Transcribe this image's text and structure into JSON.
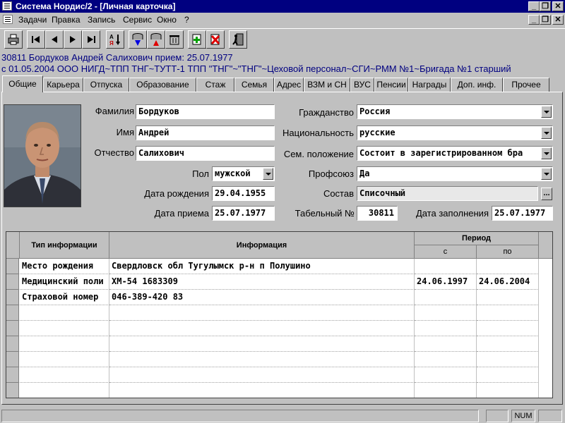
{
  "window": {
    "title": "Система Нордис/2 - [Личная карточка]"
  },
  "menu": [
    "Задачи",
    "Правка",
    "Запись",
    "Сервис",
    "Окно",
    "?"
  ],
  "toolbar": {
    "buttons": [
      "print",
      "first",
      "prev",
      "next",
      "last",
      "sort",
      "db-down",
      "db-up",
      "db-clear",
      "add",
      "delete",
      "exit"
    ]
  },
  "header": {
    "line1": "30811 Бордуков Андрей Салихович  прием: 25.07.1977",
    "line2": "с 01.05.2004  ООО НИГД~ТПП ТНГ~ТУТТ-1 ТПП \"ТНГ\"~\"ТНГ\"~Цеховой персонал~СГИ~РММ №1~Бригада №1   старший"
  },
  "tabs": [
    "Общие",
    "Карьера",
    "Отпуска",
    "Образование",
    "Стаж",
    "Семья",
    "Адрес",
    "ВЗМ и СН",
    "ВУС",
    "Пенсии",
    "Награды",
    "Доп. инф.",
    "Прочее"
  ],
  "form": {
    "surname_label": "Фамилия",
    "surname": "Бордуков",
    "name_label": "Имя",
    "name": "Андрей",
    "patronymic_label": "Отчество",
    "patronymic": "Салихович",
    "sex_label": "Пол",
    "sex": "мужской",
    "birth_label": "Дата рождения",
    "birth": "29.04.1955",
    "hire_label": "Дата приема",
    "hire": "25.07.1977",
    "citizenship_label": "Гражданство",
    "citizenship": "Россия",
    "nationality_label": "Национальность",
    "nationality": "русские",
    "marital_label": "Сем. положение",
    "marital": "Состоит в зарегистрированном бра",
    "union_label": "Профсоюз",
    "union": "Да",
    "staff_label": "Состав",
    "staff": "Списочный",
    "staff_btn": "...",
    "tabnum_label": "Табельный №",
    "tabnum": "30811",
    "filldate_label": "Дата заполнения",
    "filldate": "25.07.1977"
  },
  "grid": {
    "col_type": "Тип информации",
    "col_info": "Информация",
    "col_period": "Период",
    "col_from": "с",
    "col_to": "по",
    "rows": [
      {
        "type": "Место рождения",
        "info": "Свердловск обл Тугулымск р-н п Полушино",
        "from": "",
        "to": ""
      },
      {
        "type": "Медицинский поли",
        "info": "ХМ-54 1683309",
        "from": "24.06.1997",
        "to": "24.06.2004"
      },
      {
        "type": "Страховой номер",
        "info": "046-389-420 83",
        "from": "",
        "to": ""
      },
      {
        "type": "",
        "info": "",
        "from": "",
        "to": ""
      },
      {
        "type": "",
        "info": "",
        "from": "",
        "to": ""
      },
      {
        "type": "",
        "info": "",
        "from": "",
        "to": ""
      },
      {
        "type": "",
        "info": "",
        "from": "",
        "to": ""
      },
      {
        "type": "",
        "info": "",
        "from": "",
        "to": ""
      },
      {
        "type": "",
        "info": "",
        "from": "",
        "to": ""
      }
    ]
  },
  "status": {
    "num": "NUM"
  },
  "colors": {
    "titlebar": "#000080",
    "info_text": "#000080",
    "face": "#c0c0c0"
  }
}
